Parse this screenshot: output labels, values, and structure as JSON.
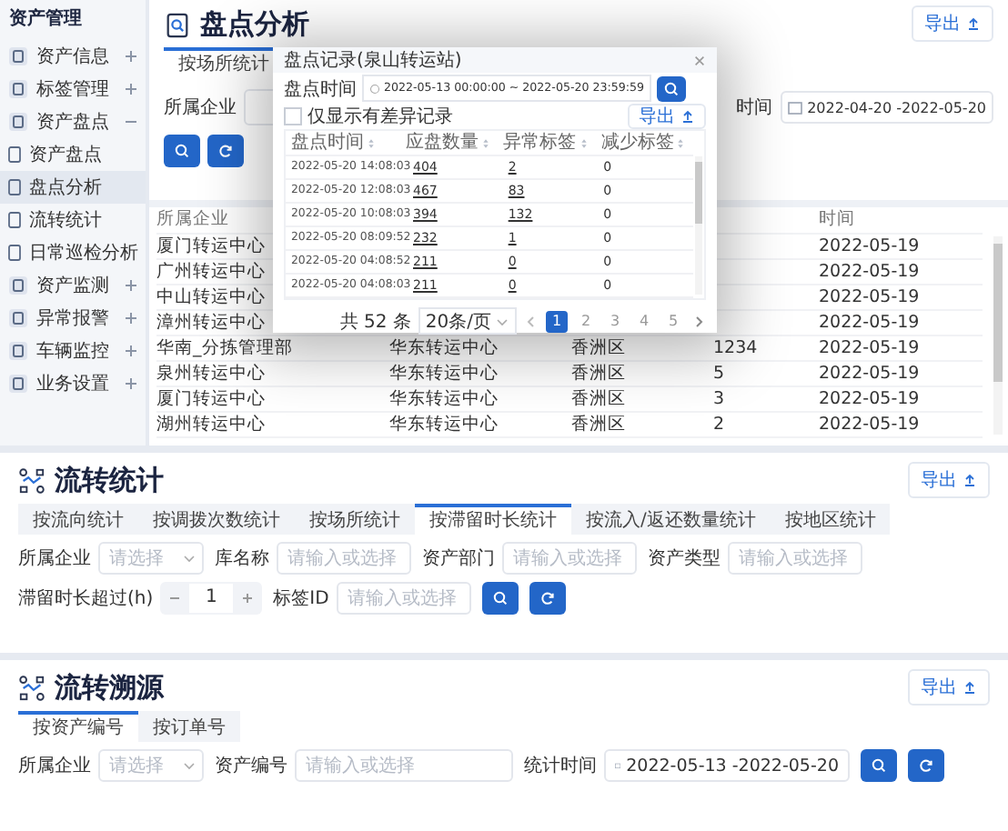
{
  "sidebar": {
    "title": "资产管理",
    "items": [
      {
        "label": "资产信息",
        "expanded": false
      },
      {
        "label": "标签管理",
        "expanded": false
      },
      {
        "label": "资产盘点",
        "expanded": true,
        "children": [
          {
            "label": "资产盘点",
            "selected": false
          },
          {
            "label": "盘点分析",
            "selected": true
          },
          {
            "label": "流转统计",
            "selected": false
          },
          {
            "label": "日常巡检分析",
            "selected": false
          }
        ]
      },
      {
        "label": "资产监测",
        "expanded": false
      },
      {
        "label": "异常报警",
        "expanded": false
      },
      {
        "label": "车辆监控",
        "expanded": false
      },
      {
        "label": "业务设置",
        "expanded": false
      }
    ]
  },
  "inventory_analysis": {
    "title": "盘点分析",
    "export": "导出",
    "tabs": [
      {
        "label": "按场所统计",
        "selected": true
      }
    ],
    "company_label": "所属企业",
    "time_label": "时间",
    "time_value": "2022-04-20 -2022-05-20",
    "table": {
      "columns": [
        "所属企业",
        "时间"
      ],
      "rows": [
        {
          "company": "厦门转运中心",
          "date": "2022-05-19"
        },
        {
          "company": "广州转运中心",
          "date": "2022-05-19"
        },
        {
          "company": "中山转运中心",
          "date": "2022-05-19"
        },
        {
          "company": "漳州转运中心",
          "date": "2022-05-19"
        },
        {
          "company": "华南_分拣管理部",
          "center": "华东转运中心",
          "district": "香洲区",
          "count": "1234",
          "date": "2022-05-19"
        },
        {
          "company": "泉州转运中心",
          "center": "华东转运中心",
          "district": "香洲区",
          "count": "5",
          "date": "2022-05-19"
        },
        {
          "company": "厦门转运中心",
          "center": "华东转运中心",
          "district": "香洲区",
          "count": "3",
          "date": "2022-05-19"
        },
        {
          "company": "湖州转运中心",
          "center": "华东转运中心",
          "district": "香洲区",
          "count": "2",
          "date": "2022-05-19"
        }
      ]
    }
  },
  "dialog": {
    "title": "盘点记录(泉山转运站)",
    "time_label": "盘点时间",
    "time_range": "2022-05-13 00:00:00 ~ 2022-05-20 23:59:59",
    "diff_only": {
      "label": "仅显示有差异记录",
      "checked": false
    },
    "export": "导出",
    "columns": [
      {
        "label": "盘点时间",
        "link": false
      },
      {
        "label": "应盘数量",
        "link": true
      },
      {
        "label": "异常标签",
        "link": true
      },
      {
        "label": "减少标签",
        "link": false
      }
    ],
    "rows": [
      [
        "2022-05-20 14:08:03",
        "404",
        "2",
        "0"
      ],
      [
        "2022-05-20 12:08:03",
        "467",
        "83",
        "0"
      ],
      [
        "2022-05-20 10:08:03",
        "394",
        "132",
        "0"
      ],
      [
        "2022-05-20 08:09:52",
        "232",
        "1",
        "0"
      ],
      [
        "2022-05-20 04:08:52",
        "211",
        "0",
        "0"
      ],
      [
        "2022-05-20 04:08:03",
        "211",
        "0",
        "0"
      ]
    ],
    "total": "共 52 条",
    "page_size": "20条/页",
    "pages": [
      {
        "label": "1",
        "selected": true
      },
      {
        "label": "2",
        "selected": false
      },
      {
        "label": "3",
        "selected": false
      },
      {
        "label": "4",
        "selected": false
      },
      {
        "label": "5",
        "selected": false
      }
    ]
  },
  "flow_stats": {
    "title": "流转统计",
    "export": "导出",
    "tabs": [
      {
        "label": "按流向统计",
        "selected": false
      },
      {
        "label": "按调拨次数统计",
        "selected": false
      },
      {
        "label": "按场所统计",
        "selected": false
      },
      {
        "label": "按滞留时长统计",
        "selected": true
      },
      {
        "label": "按流入/返还数量统计",
        "selected": false
      },
      {
        "label": "按地区统计",
        "selected": false
      }
    ],
    "filters": [
      {
        "kind": "select",
        "label": "所属企业",
        "placeholder": "请选择"
      },
      {
        "kind": "input",
        "label": "库名称",
        "placeholder": "请输入或选择"
      },
      {
        "kind": "input",
        "label": "资产部门",
        "placeholder": "请输入或选择"
      },
      {
        "kind": "input",
        "label": "资产类型",
        "placeholder": "请输入或选择"
      },
      {
        "kind": "stepper",
        "label": "滞留时长超过(h)",
        "value": "1"
      },
      {
        "kind": "input",
        "label": "标签ID",
        "placeholder": "请输入或选择"
      }
    ]
  },
  "flow_trace": {
    "title": "流转溯源",
    "export": "导出",
    "tabs": [
      {
        "label": "按资产编号",
        "selected": true
      },
      {
        "label": "按订单号",
        "selected": false
      }
    ],
    "filters": [
      {
        "kind": "select",
        "label": "所属企业",
        "placeholder": "请选择"
      },
      {
        "kind": "wide",
        "label": "资产编号",
        "placeholder": "请输入或选择"
      },
      {
        "kind": "date",
        "label": "统计时间",
        "value": "2022-05-13 -2022-05-20"
      }
    ]
  }
}
